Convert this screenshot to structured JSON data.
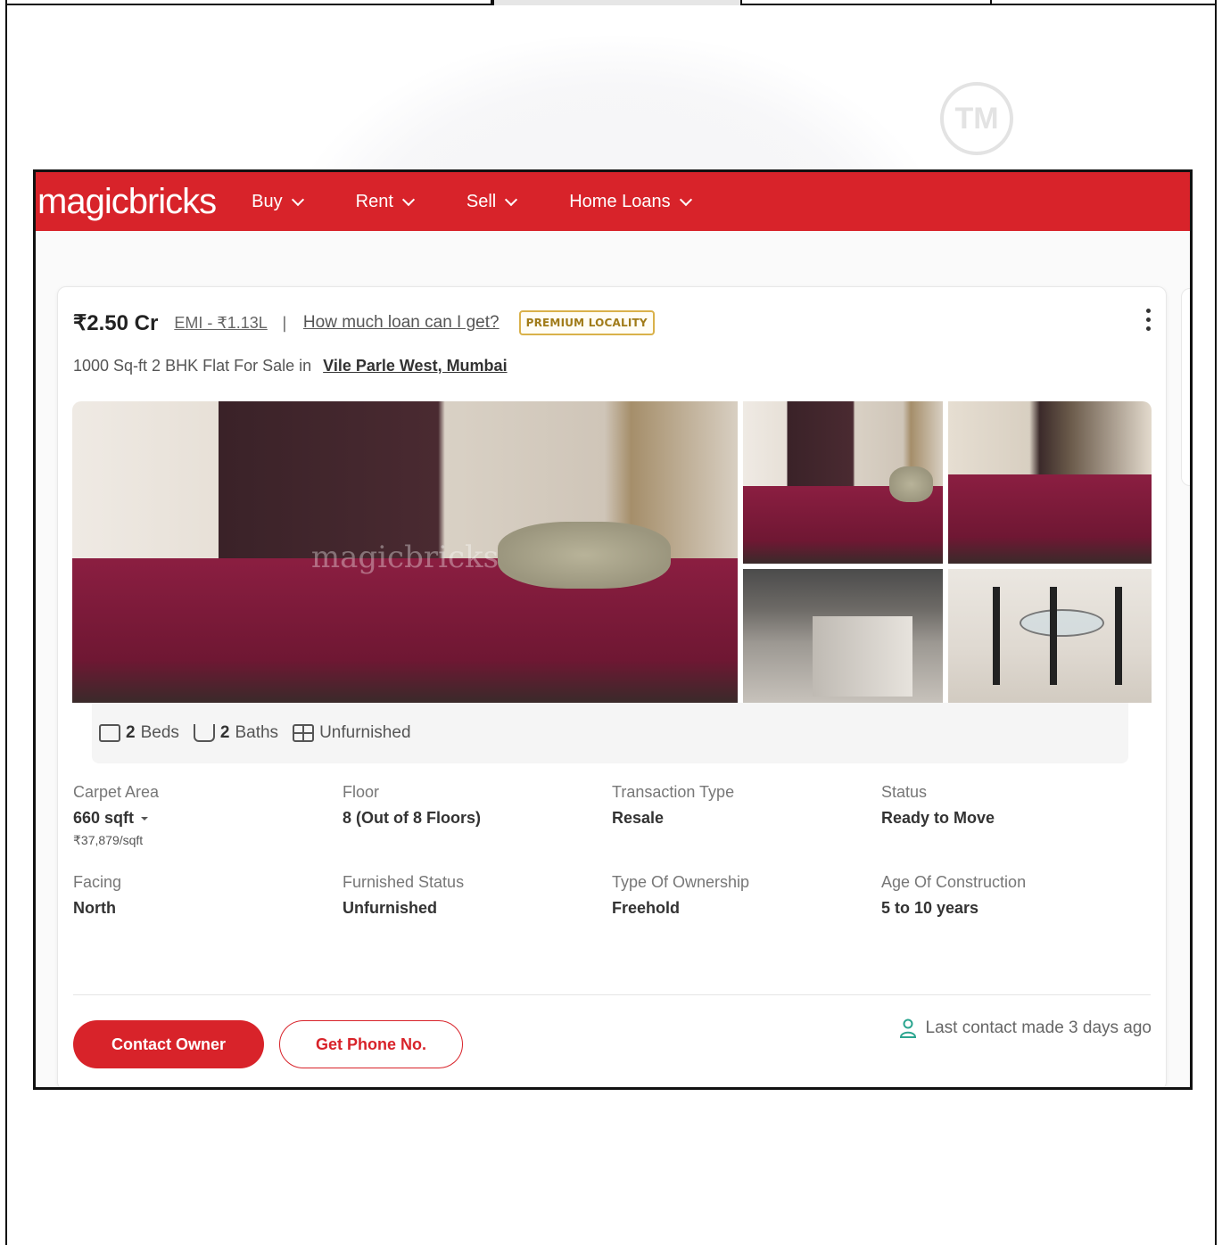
{
  "brand": {
    "logo_text": "magicbricks",
    "trademark": "TM",
    "accent_color": "#d8232a"
  },
  "nav": {
    "items": [
      {
        "label": "Buy"
      },
      {
        "label": "Rent"
      },
      {
        "label": "Sell"
      },
      {
        "label": "Home Loans"
      }
    ]
  },
  "listing": {
    "price": "₹2.50 Cr",
    "emi": "EMI - ₹1.13L",
    "separator": "|",
    "loan_link": "How much loan can I get?",
    "badge": "PREMIUM LOCALITY",
    "subtitle_prefix": "1000 Sq-ft 2 BHK Flat For Sale in",
    "location": "Vile Parle West, Mumbai",
    "photo_watermark": "magicbricks",
    "features": {
      "beds_count": "2",
      "beds_label": "Beds",
      "baths_count": "2",
      "baths_label": "Baths",
      "furnishing": "Unfurnished"
    },
    "details": [
      {
        "label": "Carpet Area",
        "value": "660 sqft",
        "sub": "₹37,879/sqft"
      },
      {
        "label": "Floor",
        "value": "8 (Out of 8 Floors)"
      },
      {
        "label": "Transaction Type",
        "value": "Resale"
      },
      {
        "label": "Status",
        "value": "Ready to Move"
      },
      {
        "label": "Facing",
        "value": "North"
      },
      {
        "label": "Furnished Status",
        "value": "Unfurnished"
      },
      {
        "label": "Type Of Ownership",
        "value": "Freehold"
      },
      {
        "label": "Age Of Construction",
        "value": "5 to 10 years"
      }
    ],
    "actions": {
      "contact_owner": "Contact Owner",
      "get_phone": "Get Phone No."
    },
    "last_contact": "Last contact made 3 days ago"
  }
}
